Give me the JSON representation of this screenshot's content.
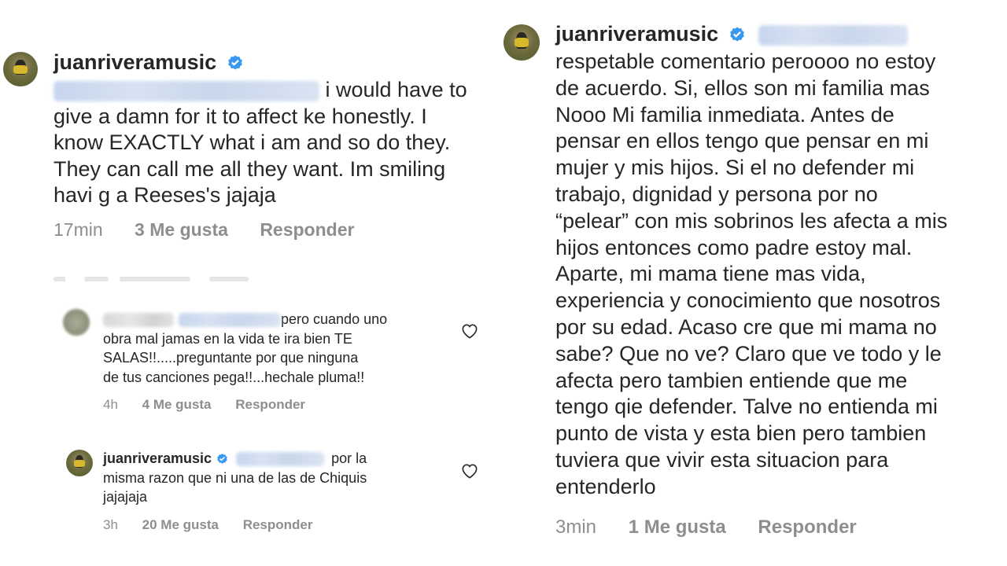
{
  "left": {
    "main_comment": {
      "username": "juanriveramusic",
      "text_lines": [
        " i would have to",
        "give a damn for it to affect ke honestly. I",
        "know EXACTLY what i am and so do they.",
        "They can call me all they want. Im smiling",
        "havi g a Reeses's jajaja"
      ],
      "time": "17min",
      "likes": "3 Me gusta",
      "reply_label": "Responder"
    },
    "reply_1": {
      "text_lines": [
        "pero cuando uno",
        "obra mal jamas en la vida te ira bien TE",
        "SALAS!!.....preguntante por que ninguna",
        "de tus canciones pega!!...hechale pluma!!"
      ],
      "time": "4h",
      "likes": "4 Me gusta",
      "reply_label": "Responder"
    },
    "reply_2": {
      "username": "juanriveramusic",
      "text_lines": [
        "por la",
        "misma razon que ni una de las de Chiquis",
        "jajajaja"
      ],
      "time": "3h",
      "likes": "20 Me gusta",
      "reply_label": "Responder"
    }
  },
  "right": {
    "comment": {
      "username": "juanriveramusic",
      "text_lines": [
        "respetable comentario peroooo no estoy",
        "de acuerdo.  Si, ellos son mi familia mas",
        "Nooo Mi familia inmediata.  Antes de",
        "pensar en ellos tengo que pensar en mi",
        "mujer y mis hijos. Si el no defender mi",
        "trabajo, dignidad y persona por no",
        "“pelear” con mis sobrinos les afecta a mis",
        "hijos entonces como padre estoy mal.",
        "Aparte, mi mama tiene mas vida,",
        "experiencia y conocimiento que nosotros",
        "por su edad. Acaso cre que mi mama no",
        "sabe? Que no ve? Claro que ve todo y le",
        "afecta pero tambien entiende que me",
        "tengo qie defender. Talve no entienda mi",
        "punto de vista y esta bien pero tambien",
        "tuviera que vivir esta situacion para",
        "entenderlo"
      ],
      "time": "3min",
      "likes": "1 Me gusta",
      "reply_label": "Responder"
    }
  },
  "colors": {
    "text": "#262626",
    "meta": "#8e8e8e",
    "verified": "#3897f0",
    "background": "#ffffff"
  },
  "icons": [
    "avatar",
    "verified-badge-icon",
    "heart-icon"
  ]
}
